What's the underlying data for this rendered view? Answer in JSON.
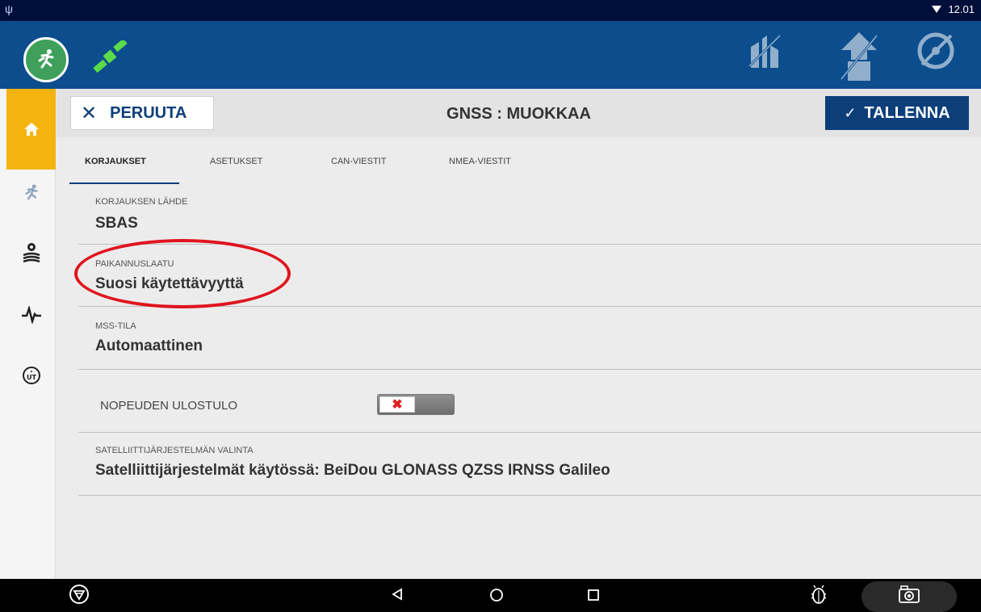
{
  "status_bar": {
    "time": "12.01"
  },
  "header": {
    "cancel_label": "PERUUTA",
    "title": "GNSS : MUOKKAA",
    "save_label": "TALLENNA"
  },
  "tabs": [
    {
      "label": "KORJAUKSET",
      "active": true
    },
    {
      "label": "ASETUKSET",
      "active": false
    },
    {
      "label": "CAN-VIESTIT",
      "active": false
    },
    {
      "label": "NMEA-VIESTIT",
      "active": false
    }
  ],
  "settings": {
    "correction_source": {
      "label": "KORJAUKSEN LÄHDE",
      "value": "SBAS"
    },
    "positioning_quality": {
      "label": "PAIKANNUSLAATU",
      "value": "Suosi käytettävyyttä"
    },
    "mss_mode": {
      "label": "MSS-TILA",
      "value": "Automaattinen"
    },
    "speed_output": {
      "label": "NOPEUDEN ULOSTULO",
      "enabled": false
    },
    "satellite_selection": {
      "label": "SATELLIITTIJÄRJESTELMÄN VALINTA",
      "value": "Satelliittijärjestelmät käytössä: BeiDou GLONASS QZSS IRNSS Galileo"
    }
  },
  "icons": {
    "status": [
      "usb-icon",
      "wifi-icon"
    ],
    "appbar": [
      "runner-icon",
      "satellite-icon",
      "implement-icon",
      "vehicle-icon",
      "steering-disabled-icon"
    ],
    "sidenav": [
      "home-icon",
      "runner-icon",
      "field-settings-icon",
      "diagnostics-icon",
      "universal-terminal-icon"
    ],
    "navbar": [
      "menu-icon",
      "back-icon",
      "home-circle-icon",
      "recents-icon",
      "debug-icon",
      "camera-icon"
    ]
  },
  "colors": {
    "appbar": "#0c4d8d",
    "accent": "#0c3e7a",
    "home_tab": "#f3b40f",
    "runner_badge": "#3ea05a",
    "highlight": "#e0141e"
  }
}
